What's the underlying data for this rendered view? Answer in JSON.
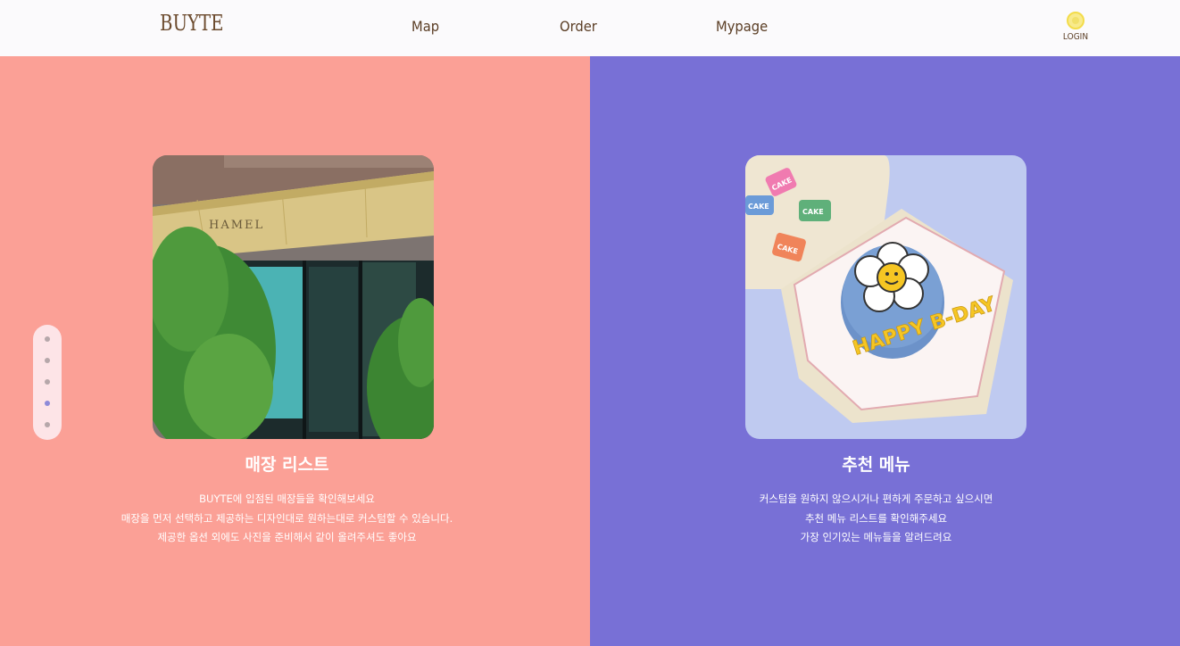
{
  "header": {
    "logo": "BUYTE",
    "nav": [
      {
        "label": "Map"
      },
      {
        "label": "Order"
      },
      {
        "label": "Mypage"
      }
    ],
    "login_label": "LOGIN",
    "login_icon": "sun-icon"
  },
  "panels": [
    {
      "title": "매장 리스트",
      "description": [
        "BUYTE에 입점된 매장들을 확인해보세요",
        "매장을 먼저 선택하고 제공하는 디자인대로 원하는대로 커스텀할 수 있습니다.",
        "제공한 옵션 외에도 사진을 준비해서 같이 올려주셔도 좋아요"
      ],
      "image_sign": "HAMEL",
      "color": "#fba096"
    },
    {
      "title": "추천 메뉴",
      "description": [
        "커스텀을 원하지 않으시거나 편하게 주문하고 싶으시면",
        "추천 메뉴 리스트를 확인해주세요",
        "가장 인기있는 메뉴들을 알려드려요"
      ],
      "image_text": "HAPPY B-DAY",
      "sticker_text": "CAKE",
      "color": "#7870d6"
    }
  ],
  "pager": {
    "count": 5,
    "active_index": 3
  }
}
